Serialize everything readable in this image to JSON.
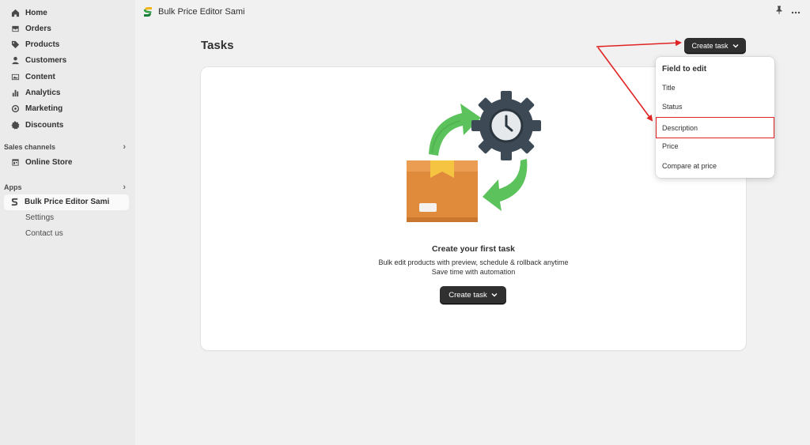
{
  "sidebar": {
    "items": [
      {
        "label": "Home",
        "icon": "home-icon"
      },
      {
        "label": "Orders",
        "icon": "orders-icon"
      },
      {
        "label": "Products",
        "icon": "tag-icon"
      },
      {
        "label": "Customers",
        "icon": "person-icon"
      },
      {
        "label": "Content",
        "icon": "content-icon"
      },
      {
        "label": "Analytics",
        "icon": "chart-icon"
      },
      {
        "label": "Marketing",
        "icon": "target-icon"
      },
      {
        "label": "Discounts",
        "icon": "discount-icon"
      }
    ],
    "sales_channels_label": "Sales channels",
    "online_store_label": "Online Store",
    "apps_label": "Apps",
    "active_app_label": "Bulk Price Editor Sami",
    "sub_items": [
      "Settings",
      "Contact us"
    ]
  },
  "topbar": {
    "app_title": "Bulk Price Editor Sami"
  },
  "main": {
    "page_title": "Tasks",
    "create_task_label": "Create task",
    "empty_state": {
      "heading": "Create your first task",
      "line1": "Bulk edit products with preview, schedule & rollback anytime",
      "line2": "Save time with automation",
      "button_label": "Create task"
    }
  },
  "dropdown": {
    "heading": "Field to edit",
    "items": [
      "Title",
      "Status",
      "Description",
      "Price",
      "Compare at price"
    ],
    "highlighted": "Description"
  },
  "colors": {
    "accent_dark": "#303030",
    "annotation_red": "#e02424",
    "box_orange": "#e08a3c",
    "gear_gray": "#3d4a55",
    "arrow_green": "#5cc25b"
  }
}
